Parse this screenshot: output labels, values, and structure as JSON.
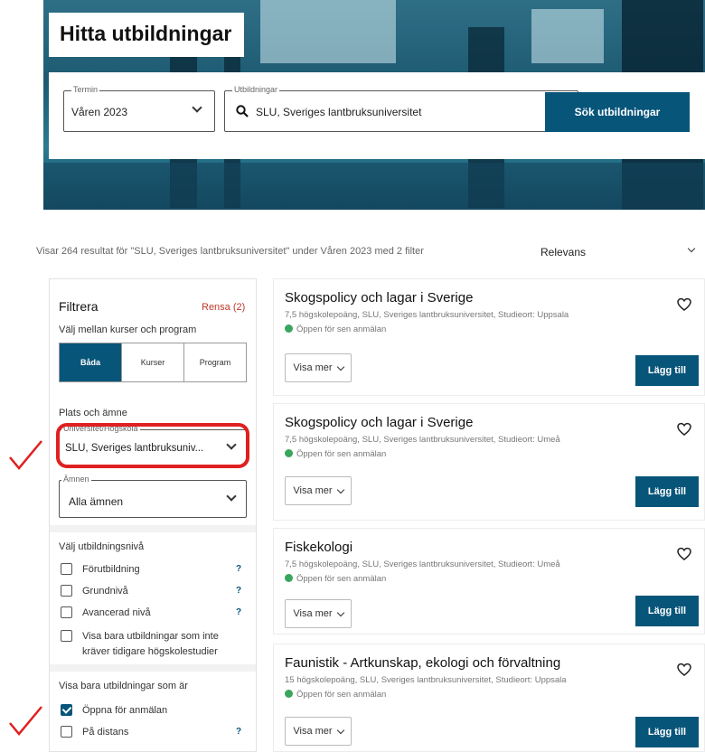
{
  "hero": {
    "title": "Hitta utbildningar"
  },
  "search": {
    "term_legend": "Termin",
    "term_value": "Våren 2023",
    "edu_legend": "Utbildningar",
    "edu_value": "SLU, Sveriges lantbruksuniversitet",
    "submit_label": "Sök utbildningar"
  },
  "results": {
    "summary": "Visar 264 resultat för \"SLU, Sveriges lantbruksuniversitet\" under Våren 2023 med 2 filter",
    "sort_label": "Relevans"
  },
  "filters": {
    "title": "Filtrera",
    "reset_label": "Rensa (2)",
    "choose_type_label": "Välj mellan kurser och program",
    "type_options": [
      "Båda",
      "Kurser",
      "Program"
    ],
    "place_subject_label": "Plats och ämne",
    "university_legend": "Universitet/Högskola",
    "university_value": "SLU, Sveriges lantbruksuniv...",
    "subject_legend": "Ämnen",
    "subject_value": "Alla ämnen",
    "level_label": "Välj utbildningsnivå",
    "levels": [
      {
        "label": "Förutbildning",
        "help": "?"
      },
      {
        "label": "Grundnivå",
        "help": "?"
      },
      {
        "label": "Avancerad nivå",
        "help": "?"
      }
    ],
    "no_prior_line1": "Visa bara utbildningar som inte",
    "no_prior_line2": "kräver tidigare högskolestudier",
    "show_only_label": "Visa bara utbildningar som är",
    "open_label": "Öppna för anmälan",
    "distance_label": "På distans",
    "distance_help": "?"
  },
  "courses": [
    {
      "title": "Skogspolicy och lagar i Sverige",
      "meta": "7,5 högskolepoäng, SLU, Sveriges lantbruksuniversitet, Studieort: Uppsala",
      "status": "Öppen för sen anmälan",
      "more_label": "Visa mer",
      "add_label": "Lägg till"
    },
    {
      "title": "Skogspolicy och lagar i Sverige",
      "meta": "7,5 högskolepoäng, SLU, Sveriges lantbruksuniversitet, Studieort: Umeå",
      "status": "Öppen för sen anmälan",
      "more_label": "Visa mer",
      "add_label": "Lägg till"
    },
    {
      "title": "Fiskekologi",
      "meta": "7,5 högskolepoäng, SLU, Sveriges lantbruksuniversitet, Studieort: Umeå",
      "status": "Öppen för sen anmälan",
      "more_label": "Visa mer",
      "add_label": "Lägg till"
    },
    {
      "title": "Faunistik - Artkunskap, ekologi och förvaltning",
      "meta": "15 högskolepoäng, SLU, Sveriges lantbruksuniversitet, Studieort: Uppsala",
      "status": "Öppen för sen anmälan",
      "more_label": "Visa mer",
      "add_label": "Lägg till"
    }
  ],
  "colors": {
    "primary": "#08557a",
    "annotation": "#e02020",
    "open_dot": "#3aa55d"
  }
}
